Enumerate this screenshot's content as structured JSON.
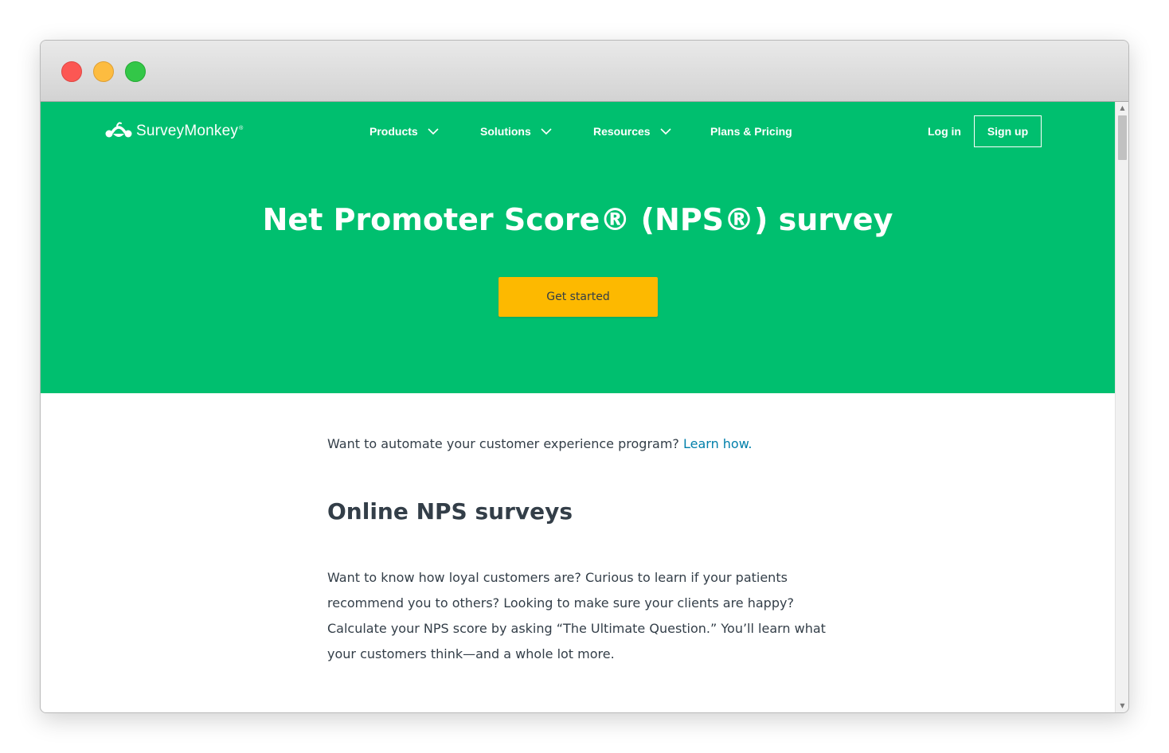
{
  "brand": {
    "name": "SurveyMonkey",
    "registered": "®"
  },
  "nav": {
    "items": [
      {
        "label": "Products",
        "has_dropdown": true
      },
      {
        "label": "Solutions",
        "has_dropdown": true
      },
      {
        "label": "Resources",
        "has_dropdown": true
      },
      {
        "label": "Plans & Pricing",
        "has_dropdown": false
      }
    ],
    "login_label": "Log in",
    "signup_label": "Sign up"
  },
  "hero": {
    "title": "Net Promoter Score® (NPS®) survey",
    "cta_label": "Get started",
    "background_color": "#00bf6f",
    "cta_color": "#fdb900"
  },
  "main": {
    "intro_text": "Want to automate your customer experience program? ",
    "intro_link": "Learn how.",
    "section_title": "Online NPS surveys",
    "paragraph_lines": [
      "Want to know how loyal customers are? Curious to learn if your patients",
      "recommend you to others? Looking to make sure your clients are happy?",
      "Calculate your NPS score by asking “The Ultimate Question.” You’ll learn what",
      "your customers think—and a whole lot more."
    ],
    "link_color": "#007faa",
    "text_color": "#333e48"
  },
  "icons": {
    "logo": "monkey-logo-icon",
    "dropdown": "chevron-down-icon",
    "scroll_up": "scroll-up-arrow-icon",
    "scroll_down": "scroll-down-arrow-icon"
  }
}
